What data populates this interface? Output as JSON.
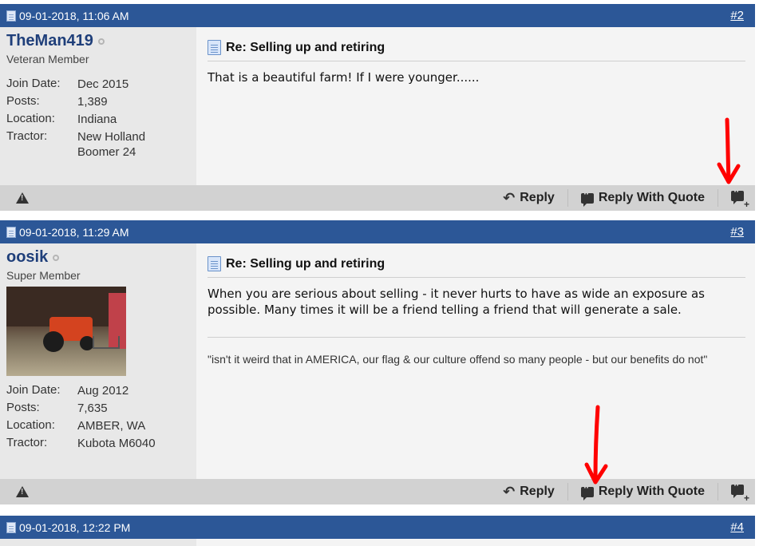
{
  "posts": [
    {
      "date": "09-01-2018, 11:06 AM",
      "number": "#2",
      "username": "TheMan419",
      "usertitle": "Veteran Member",
      "stats": [
        {
          "k": "Join Date:",
          "v": "Dec 2015"
        },
        {
          "k": "Posts:",
          "v": "1,389"
        },
        {
          "k": "Location:",
          "v": "Indiana"
        },
        {
          "k": "Tractor:",
          "v": "New Holland Boomer 24"
        }
      ],
      "title": "Re: Selling up and retiring",
      "message": "That is a beautiful farm! If I were younger......"
    },
    {
      "date": "09-01-2018, 11:29 AM",
      "number": "#3",
      "username": "oosik",
      "usertitle": "Super Member",
      "stats": [
        {
          "k": "Join Date:",
          "v": "Aug 2012"
        },
        {
          "k": "Posts:",
          "v": "7,635"
        },
        {
          "k": "Location:",
          "v": "AMBER, WA"
        },
        {
          "k": "Tractor:",
          "v": "Kubota M6040"
        }
      ],
      "title": "Re: Selling up and retiring",
      "message": "When you are serious about selling - it never hurts to have as wide an exposure as possible. Many times it will be a friend telling a friend that will generate a sale.",
      "signature": "\"isn't it weird that in AMERICA, our flag & our culture offend so many people - but our benefits do not\""
    },
    {
      "date": "09-01-2018, 12:22 PM",
      "number": "#4"
    }
  ],
  "actions": {
    "reply": "Reply",
    "reply_with_quote": "Reply With Quote"
  },
  "icons": {
    "post": "document-icon",
    "warn": "warning-icon",
    "reply": "reply-arrow-icon",
    "quote": "quote-bubble-icon",
    "multiquote": "multiquote-plus-icon"
  },
  "colors": {
    "header": "#2c5797",
    "annotation_arrow": "#ff0000"
  }
}
